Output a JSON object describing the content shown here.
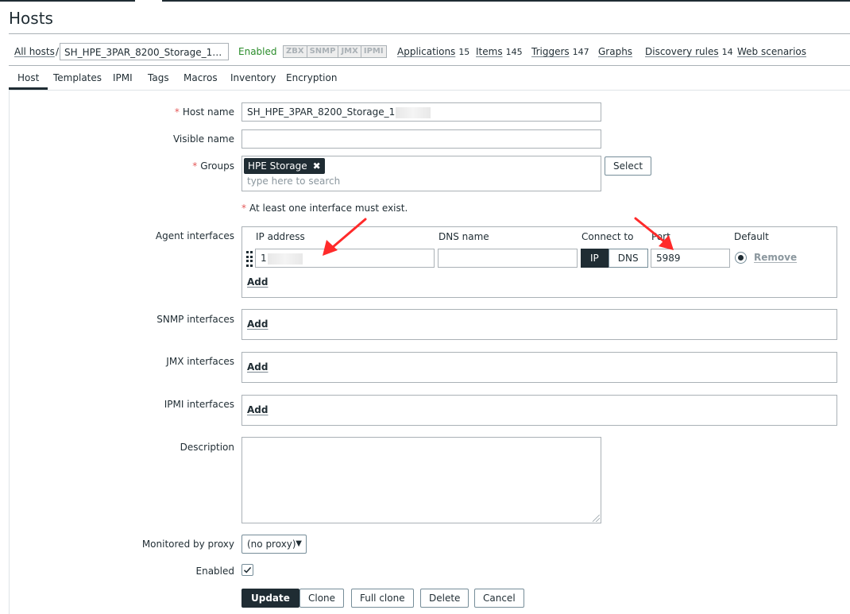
{
  "page": {
    "title": "Hosts"
  },
  "breadcrumb": {
    "all_hosts": "All hosts",
    "separator": "/",
    "host_name": "SH_HPE_3PAR_8200_Storage_1…",
    "status": "Enabled",
    "status_color": "#2a8c2a",
    "availability": [
      "ZBX",
      "SNMP",
      "JMX",
      "IPMI"
    ],
    "links": {
      "applications": {
        "label": "Applications",
        "count": "15"
      },
      "items": {
        "label": "Items",
        "count": "145"
      },
      "triggers": {
        "label": "Triggers",
        "count": "147"
      },
      "graphs": {
        "label": "Graphs"
      },
      "discovery_rules": {
        "label": "Discovery rules",
        "count": "14"
      },
      "web_scenarios": {
        "label": "Web scenarios"
      }
    }
  },
  "tabs": [
    "Host",
    "Templates",
    "IPMI",
    "Tags",
    "Macros",
    "Inventory",
    "Encryption"
  ],
  "active_tab": "Host",
  "form": {
    "host_name": {
      "label": "Host name",
      "required_mark": "*",
      "value": "SH_HPE_3PAR_8200_Storage_1"
    },
    "visible_name": {
      "label": "Visible name",
      "value": ""
    },
    "groups": {
      "label": "Groups",
      "required_mark": "*",
      "chips": [
        "HPE Storage"
      ],
      "placeholder": "type here to search",
      "select_label": "Select"
    },
    "interface_note": {
      "required_mark": "*",
      "text": "At least one interface must exist."
    },
    "agent_interfaces": {
      "label": "Agent interfaces",
      "columns": {
        "ip": "IP address",
        "dns": "DNS name",
        "connect_to": "Connect to",
        "port": "Port",
        "default": "Default"
      },
      "row": {
        "ip": "1",
        "dns": "",
        "connect_options": [
          "IP",
          "DNS"
        ],
        "connect_selected": "IP",
        "port": "5989",
        "remove_label": "Remove"
      },
      "add_label": "Add"
    },
    "snmp_interfaces": {
      "label": "SNMP interfaces",
      "add_label": "Add"
    },
    "jmx_interfaces": {
      "label": "JMX interfaces",
      "add_label": "Add"
    },
    "ipmi_interfaces": {
      "label": "IPMI interfaces",
      "add_label": "Add"
    },
    "description": {
      "label": "Description",
      "value": ""
    },
    "proxy": {
      "label": "Monitored by proxy",
      "value": "(no proxy)"
    },
    "enabled": {
      "label": "Enabled",
      "checked": true
    },
    "buttons": {
      "update": "Update",
      "clone": "Clone",
      "full_clone": "Full clone",
      "delete": "Delete",
      "cancel": "Cancel"
    }
  },
  "colors": {
    "primary": "#1f2c33",
    "required": "#e45959",
    "annotation_arrow": "#ff2a2a"
  },
  "icons": {
    "chip_remove": "close-icon",
    "checkbox": "checkmark-icon",
    "drag": "drag-handle-icon",
    "select": "chevron-down-icon"
  }
}
